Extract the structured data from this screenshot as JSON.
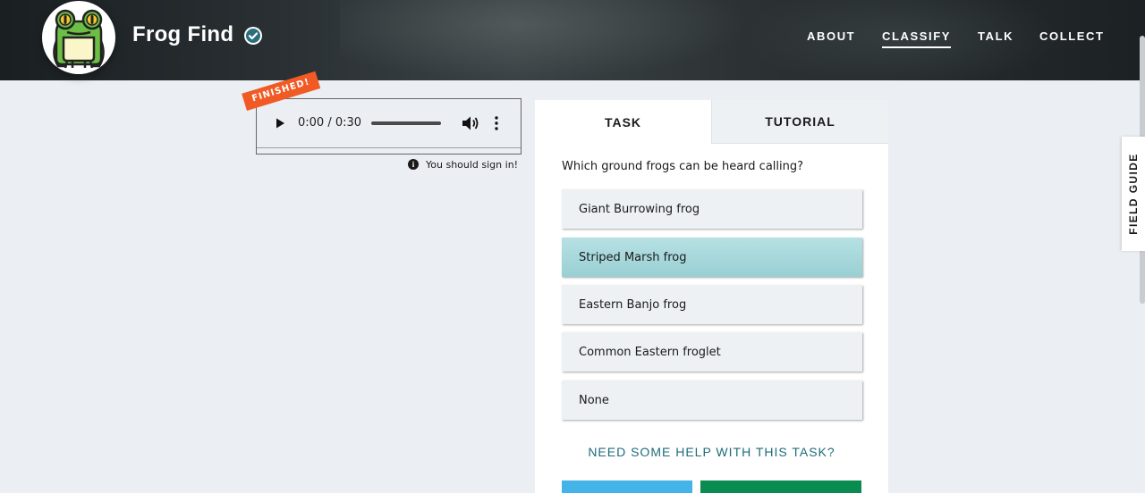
{
  "header": {
    "brand": "Frog Find",
    "nav": [
      "ABOUT",
      "CLASSIFY",
      "TALK",
      "COLLECT"
    ],
    "active_nav": "CLASSIFY"
  },
  "subject": {
    "badge": "FINISHED!",
    "time": "0:00 / 0:30",
    "signin_text": "You should sign in!"
  },
  "task_panel": {
    "tabs": [
      "TASK",
      "TUTORIAL"
    ],
    "question": "Which ground frogs can be heard calling?",
    "answers": [
      {
        "label": "Giant Burrowing frog",
        "selected": false
      },
      {
        "label": "Striped Marsh frog",
        "selected": true
      },
      {
        "label": "Eastern Banjo frog",
        "selected": false
      },
      {
        "label": "Common Eastern froglet",
        "selected": false
      },
      {
        "label": "None",
        "selected": false
      }
    ],
    "help": "NEED SOME HELP WITH THIS TASK?"
  },
  "field_guide": "FIELD GUIDE",
  "colors": {
    "accent_teal": "#99cfd3",
    "help_link": "#1e6c7a",
    "badge_orange": "#f15a24",
    "done_green": "#0a8b4f",
    "talk_blue": "#44b4e8"
  }
}
